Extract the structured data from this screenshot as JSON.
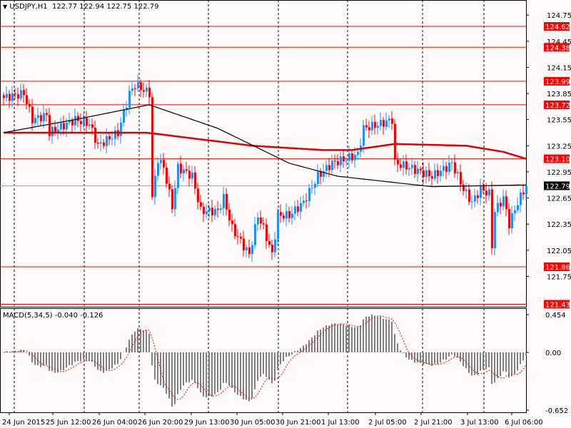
{
  "header": {
    "symbol": "USDJPY,H1",
    "ohlc": "122.77 122.94 122.75 122.79"
  },
  "macd": {
    "label": "MACD(5,34,5) -0.040 -0.126"
  },
  "colors": {
    "bull": "#1e90ff",
    "bear": "#ff0000",
    "ma_fast": "#000000",
    "ma_slow": "#e00000",
    "level": "#ff0000"
  },
  "chart_data": {
    "type": "candlestick",
    "price_ticks": [
      "124.75",
      "124.45",
      "124.15",
      "123.85",
      "123.55",
      "123.25",
      "122.95",
      "122.65",
      "122.35",
      "122.05",
      "121.75"
    ],
    "levels": [
      "124.62",
      "124.38",
      "123.99",
      "123.72",
      "123.10",
      "121.86",
      "121.43"
    ],
    "current_price": "122.79",
    "x_labels": [
      "24 Jun 2015",
      "25 Jun 12:00",
      "26 Jun 04:00",
      "26 Jun 20:00",
      "29 Jun 13:00",
      "30 Jun 05:00",
      "30 Jun 21:00",
      "1 Jul 13:00",
      "2 Jul 05:00",
      "2 Jul 21:00",
      "3 Jul 13:00",
      "6 Jul 06:00"
    ],
    "close_path": [
      [
        0,
        123.8
      ],
      [
        7,
        123.85
      ],
      [
        10,
        123.55
      ],
      [
        15,
        123.6
      ],
      [
        16,
        123.4
      ],
      [
        25,
        123.55
      ],
      [
        30,
        123.5
      ],
      [
        33,
        123.25
      ],
      [
        40,
        123.4
      ],
      [
        44,
        123.85
      ],
      [
        46,
        123.95
      ],
      [
        51,
        123.85
      ],
      [
        52,
        122.65
      ],
      [
        54,
        123.1
      ],
      [
        56,
        123.0
      ],
      [
        59,
        122.55
      ],
      [
        61,
        123.0
      ],
      [
        66,
        122.9
      ],
      [
        69,
        122.5
      ],
      [
        75,
        122.5
      ],
      [
        77,
        122.65
      ],
      [
        80,
        122.3
      ],
      [
        86,
        122.0
      ],
      [
        89,
        122.45
      ],
      [
        91,
        122.3
      ],
      [
        94,
        122.0
      ],
      [
        96,
        122.45
      ],
      [
        100,
        122.45
      ],
      [
        105,
        122.6
      ],
      [
        110,
        122.9
      ],
      [
        115,
        123.05
      ],
      [
        120,
        123.1
      ],
      [
        124,
        123.15
      ],
      [
        126,
        123.45
      ],
      [
        132,
        123.5
      ],
      [
        136,
        123.55
      ],
      [
        137,
        123.05
      ],
      [
        142,
        123.0
      ],
      [
        150,
        122.9
      ],
      [
        155,
        123.0
      ],
      [
        157,
        123.05
      ],
      [
        161,
        122.75
      ],
      [
        164,
        122.6
      ],
      [
        167,
        122.75
      ],
      [
        170,
        122.7
      ],
      [
        171,
        122.1
      ],
      [
        172,
        122.5
      ],
      [
        175,
        122.65
      ],
      [
        177,
        122.35
      ],
      [
        180,
        122.6
      ],
      [
        183,
        122.79
      ]
    ],
    "ma_fast_path": [
      [
        0,
        123.4
      ],
      [
        25,
        123.55
      ],
      [
        51,
        123.72
      ],
      [
        75,
        123.45
      ],
      [
        100,
        123.05
      ],
      [
        117,
        122.9
      ],
      [
        150,
        122.78
      ],
      [
        183,
        122.8
      ]
    ],
    "ma_slow_path": [
      [
        0,
        123.4
      ],
      [
        50,
        123.4
      ],
      [
        87,
        123.25
      ],
      [
        112,
        123.2
      ],
      [
        122,
        123.2
      ],
      [
        137,
        123.27
      ],
      [
        162,
        123.25
      ],
      [
        175,
        123.18
      ],
      [
        183,
        123.1
      ]
    ],
    "macd_ticks": [
      "0.454",
      "0.00",
      "-0.652"
    ],
    "macd_range": [
      -0.652,
      0.454
    ]
  }
}
